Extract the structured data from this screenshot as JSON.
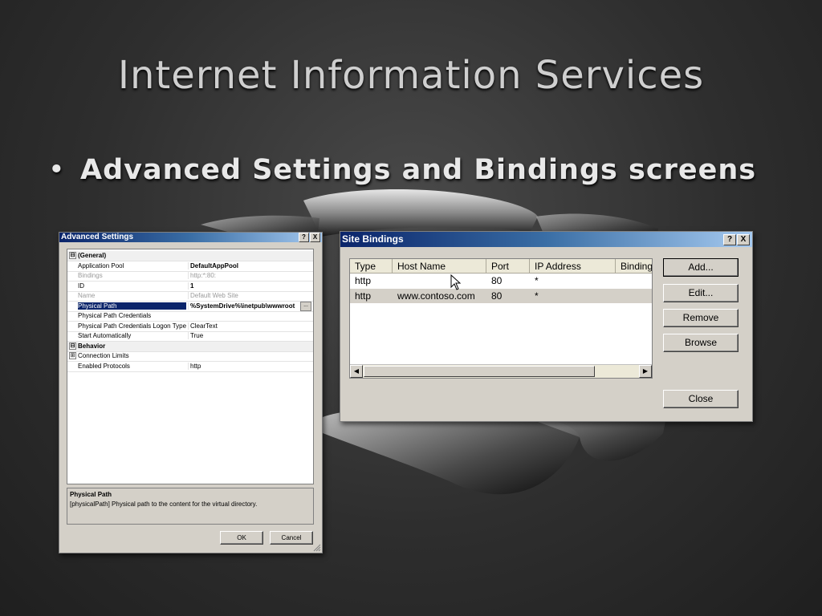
{
  "slide": {
    "title": "Internet Information Services",
    "bullet": "Advanced Settings and Bindings screens"
  },
  "advanced_settings": {
    "title": "Advanced Settings",
    "help_glyph": "?",
    "close_glyph": "X",
    "rows": [
      {
        "kind": "category",
        "expander": "⊟",
        "key": "(General)",
        "value": ""
      },
      {
        "kind": "prop",
        "key": "Application Pool",
        "value": "DefaultAppPool",
        "style": "bold"
      },
      {
        "kind": "prop",
        "key": "Bindings",
        "value": "http:*:80:",
        "style": "dim"
      },
      {
        "kind": "prop",
        "key": "ID",
        "value": "1",
        "style": "bold"
      },
      {
        "kind": "prop",
        "key": "Name",
        "value": "Default Web Site",
        "style": "dim"
      },
      {
        "kind": "prop",
        "key": "Physical Path",
        "value": "%SystemDrive%\\inetpub\\wwwroot",
        "style": "sel"
      },
      {
        "kind": "prop",
        "key": "Physical Path Credentials",
        "value": ""
      },
      {
        "kind": "prop",
        "key": "Physical Path Credentials Logon Type",
        "value": "ClearText"
      },
      {
        "kind": "prop",
        "key": "Start Automatically",
        "value": "True"
      },
      {
        "kind": "category",
        "expander": "⊟",
        "key": "Behavior",
        "value": ""
      },
      {
        "kind": "prop",
        "expander": "⊞",
        "key": "Connection Limits",
        "value": ""
      },
      {
        "kind": "prop",
        "key": "Enabled Protocols",
        "value": "http"
      }
    ],
    "browse_glyph": "...",
    "description": {
      "title": "Physical Path",
      "text": "[physicalPath] Physical path to the content for the virtual directory."
    },
    "ok_label": "OK",
    "cancel_label": "Cancel"
  },
  "site_bindings": {
    "title": "Site Bindings",
    "help_glyph": "?",
    "close_glyph": "X",
    "columns": [
      "Type",
      "Host Name",
      "Port",
      "IP Address",
      "Binding"
    ],
    "rows": [
      {
        "type": "http",
        "host": "",
        "port": "80",
        "ip": "*"
      },
      {
        "type": "http",
        "host": "www.contoso.com",
        "port": "80",
        "ip": "*"
      }
    ],
    "scroll_left": "◀",
    "scroll_right": "▶",
    "buttons": {
      "add": "Add...",
      "edit": "Edit...",
      "remove": "Remove",
      "browse": "Browse",
      "close": "Close"
    }
  }
}
